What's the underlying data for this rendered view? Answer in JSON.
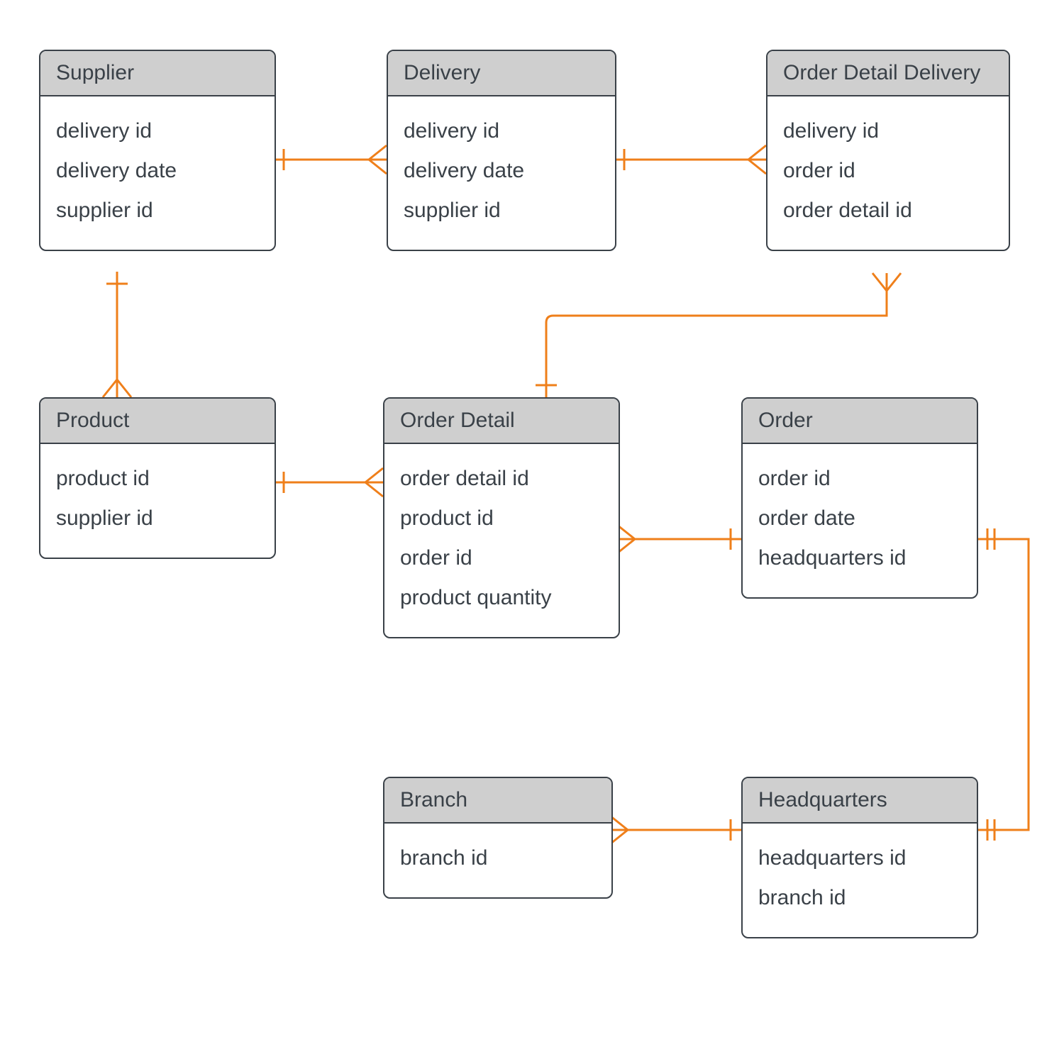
{
  "diagram_type": "Entity-Relationship Diagram",
  "accent_color": "#ef7f1a",
  "entities": {
    "supplier": {
      "title": "Supplier",
      "attrs": [
        "delivery id",
        "delivery date",
        "supplier id"
      ]
    },
    "delivery": {
      "title": "Delivery",
      "attrs": [
        "delivery id",
        "delivery date",
        "supplier id"
      ]
    },
    "odd": {
      "title": "Order Detail Delivery",
      "attrs": [
        "delivery id",
        "order id",
        "order detail id"
      ]
    },
    "product": {
      "title": "Product",
      "attrs": [
        "product id",
        "supplier id"
      ]
    },
    "orderdetail": {
      "title": "Order Detail",
      "attrs": [
        "order detail id",
        "product id",
        "order id",
        "product quantity"
      ]
    },
    "order": {
      "title": "Order",
      "attrs": [
        "order id",
        "order date",
        "headquarters id"
      ]
    },
    "branch": {
      "title": "Branch",
      "attrs": [
        "branch id"
      ]
    },
    "hq": {
      "title": "Headquarters",
      "attrs": [
        "headquarters id",
        "branch id"
      ]
    }
  },
  "relationships": [
    {
      "from": "supplier",
      "to": "delivery",
      "from_card": "one",
      "to_card": "many"
    },
    {
      "from": "delivery",
      "to": "odd",
      "from_card": "one",
      "to_card": "many"
    },
    {
      "from": "supplier",
      "to": "product",
      "from_card": "one",
      "to_card": "many"
    },
    {
      "from": "product",
      "to": "orderdetail",
      "from_card": "one",
      "to_card": "many"
    },
    {
      "from": "order",
      "to": "orderdetail",
      "from_card": "one",
      "to_card": "many"
    },
    {
      "from": "orderdetail",
      "to": "odd",
      "from_card": "one",
      "to_card": "many"
    },
    {
      "from": "hq",
      "to": "order",
      "from_card": "one-and-only-one",
      "to_card": "one-and-only-one"
    },
    {
      "from": "hq",
      "to": "branch",
      "from_card": "one",
      "to_card": "many"
    }
  ]
}
